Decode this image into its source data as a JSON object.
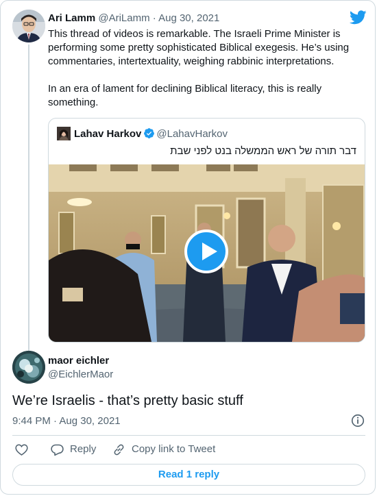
{
  "original_tweet": {
    "display_name": "Ari Lamm",
    "handle": "@AriLamm",
    "separator": "·",
    "date": "Aug 30, 2021",
    "paragraphs": [
      "This thread of videos is remarkable. The Israeli Prime Minister is performing some pretty sophisticated Biblical exegesis. He’s using commentaries, intertextuality, weighing rabbinic interpretations.",
      "In an era of lament for declining Biblical literacy, this is really something."
    ]
  },
  "quoted_tweet": {
    "display_name": "Lahav Harkov",
    "handle": "@LahavHarkov",
    "verified_icon": "verified-badge-icon",
    "text": "דבר תורה של ראש הממשלה בנט לפני שבת",
    "media": {
      "type": "video",
      "play_icon": "play-icon"
    }
  },
  "reply_tweet": {
    "display_name": "maor eichler",
    "handle": "@EichlerMaor",
    "text": "We’re Israelis - that’s pretty basic stuff",
    "time": "9:44 PM",
    "separator": "·",
    "date": "Aug 30, 2021"
  },
  "actions": {
    "like_icon": "heart-icon",
    "reply_label": "Reply",
    "copy_label": "Copy link to Tweet"
  },
  "footer": {
    "read_replies_label": "Read 1 reply"
  },
  "colors": {
    "accent": "#1d9bf0",
    "text": "#0f1419",
    "muted": "#536471",
    "border": "#cfd9de"
  }
}
